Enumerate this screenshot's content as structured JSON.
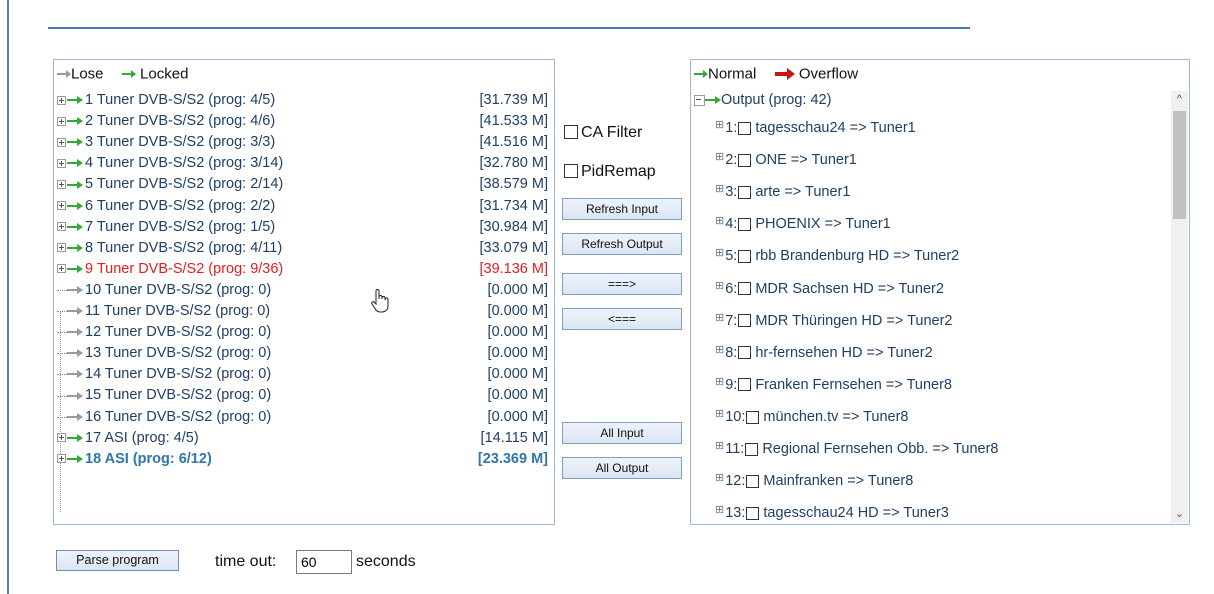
{
  "colors": {
    "accent": "#2f77aa",
    "text": "#1f3f66",
    "locked_arrow": "#33aa33",
    "lose_arrow": "#999999",
    "overflow_arrow": "#cc1111",
    "error": "#e02020"
  },
  "left_panel": {
    "legend": {
      "lose": "Lose",
      "locked": "Locked"
    },
    "inputs": [
      {
        "label": "1 Tuner DVB-S/S2 (prog: 4/5)",
        "rate": "[31.739 M]",
        "state": "locked",
        "expandable": true
      },
      {
        "label": "2 Tuner DVB-S/S2 (prog: 4/6)",
        "rate": "[41.533 M]",
        "state": "locked",
        "expandable": true
      },
      {
        "label": "3 Tuner DVB-S/S2 (prog: 3/3)",
        "rate": "[41.516 M]",
        "state": "locked",
        "expandable": true
      },
      {
        "label": "4 Tuner DVB-S/S2 (prog: 3/14)",
        "rate": "[32.780 M]",
        "state": "locked",
        "expandable": true
      },
      {
        "label": "5 Tuner DVB-S/S2 (prog: 2/14)",
        "rate": "[38.579 M]",
        "state": "locked",
        "expandable": true
      },
      {
        "label": "6 Tuner DVB-S/S2 (prog: 2/2)",
        "rate": "[31.734 M]",
        "state": "locked",
        "expandable": true
      },
      {
        "label": "7 Tuner DVB-S/S2 (prog: 1/5)",
        "rate": "[30.984 M]",
        "state": "locked",
        "expandable": true
      },
      {
        "label": "8 Tuner DVB-S/S2 (prog: 4/11)",
        "rate": "[33.079 M]",
        "state": "locked",
        "expandable": true
      },
      {
        "label": "9 Tuner DVB-S/S2 (prog: 9/36)",
        "rate": "[39.136 M]",
        "state": "locked",
        "expandable": true,
        "highlight": "red"
      },
      {
        "label": "10 Tuner DVB-S/S2 (prog: 0)",
        "rate": "[0.000 M]",
        "state": "lose",
        "expandable": false
      },
      {
        "label": "11 Tuner DVB-S/S2 (prog: 0)",
        "rate": "[0.000 M]",
        "state": "lose",
        "expandable": false
      },
      {
        "label": "12 Tuner DVB-S/S2 (prog: 0)",
        "rate": "[0.000 M]",
        "state": "lose",
        "expandable": false
      },
      {
        "label": "13 Tuner DVB-S/S2 (prog: 0)",
        "rate": "[0.000 M]",
        "state": "lose",
        "expandable": false
      },
      {
        "label": "14 Tuner DVB-S/S2 (prog: 0)",
        "rate": "[0.000 M]",
        "state": "lose",
        "expandable": false
      },
      {
        "label": "15 Tuner DVB-S/S2 (prog: 0)",
        "rate": "[0.000 M]",
        "state": "lose",
        "expandable": false
      },
      {
        "label": "16 Tuner DVB-S/S2 (prog: 0)",
        "rate": "[0.000 M]",
        "state": "lose",
        "expandable": false
      },
      {
        "label": "17 ASI (prog: 4/5)",
        "rate": "[14.115 M]",
        "state": "locked",
        "expandable": true
      },
      {
        "label": "18 ASI (prog: 6/12)",
        "rate": "[23.369 M]",
        "state": "locked",
        "expandable": true,
        "highlight": "bold"
      }
    ]
  },
  "controls": {
    "ca_filter": {
      "label": "CA Filter",
      "checked": false
    },
    "pid_remap": {
      "label": "PidRemap",
      "checked": false
    },
    "refresh_input": "Refresh Input",
    "refresh_output": "Refresh Output",
    "add": "===>",
    "remove": "<===",
    "all_input": "All Input",
    "all_output": "All Output"
  },
  "right_panel": {
    "legend": {
      "normal": "Normal",
      "overflow": "Overflow"
    },
    "root_label": "Output (prog: 42)",
    "outputs": [
      {
        "index": "1:",
        "label": "tagesschau24 => Tuner1"
      },
      {
        "index": "2:",
        "label": "ONE => Tuner1"
      },
      {
        "index": "3:",
        "label": "arte => Tuner1"
      },
      {
        "index": "4:",
        "label": "PHOENIX => Tuner1"
      },
      {
        "index": "5:",
        "label": "rbb Brandenburg HD => Tuner2"
      },
      {
        "index": "6:",
        "label": "MDR Sachsen HD => Tuner2"
      },
      {
        "index": "7:",
        "label": "MDR Thüringen HD => Tuner2"
      },
      {
        "index": "8:",
        "label": "hr-fernsehen HD => Tuner2"
      },
      {
        "index": "9:",
        "label": "Franken Fernsehen => Tuner8"
      },
      {
        "index": "10:",
        "label": "münchen.tv => Tuner8"
      },
      {
        "index": "11:",
        "label": "Regional Fernsehen Obb. => Tuner8"
      },
      {
        "index": "12:",
        "label": "Mainfranken => Tuner8"
      },
      {
        "index": "13:",
        "label": "tagesschau24 HD => Tuner3"
      }
    ]
  },
  "footer": {
    "parse_button": "Parse program",
    "timeout_label": "time out:",
    "timeout_value": "60",
    "seconds_label": "seconds"
  }
}
